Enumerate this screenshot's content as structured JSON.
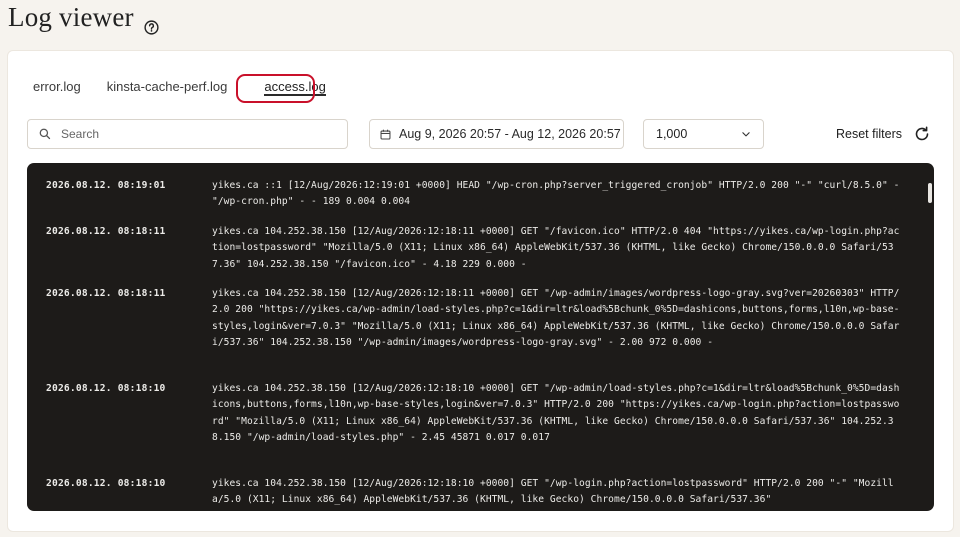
{
  "page": {
    "title": "Log viewer",
    "help_icon": "question-circle-icon"
  },
  "tabs": [
    {
      "label": "error.log",
      "active": false
    },
    {
      "label": "kinsta-cache-perf.log",
      "active": false
    },
    {
      "label": "access.log",
      "active": true
    }
  ],
  "filters": {
    "search_placeholder": "Search",
    "date_range": "Aug 9, 2026 20:57 - Aug 12, 2026 20:57",
    "lines_value": "1,000",
    "reset_label": "Reset filters"
  },
  "colors": {
    "highlight": "#c9102a",
    "log_bg": "#1d1b19"
  },
  "log_entries": [
    {
      "time": "2026.08.12. 08:19:01",
      "message": "yikes.ca ::1 [12/Aug/2026:12:19:01 +0000] HEAD \"/wp-cron.php?server_triggered_cronjob\" HTTP/2.0 200 \"-\" \"curl/8.5.0\" - \"/wp-cron.php\" - - 189 0.004 0.004"
    },
    {
      "time": "2026.08.12. 08:18:11",
      "message": "yikes.ca 104.252.38.150 [12/Aug/2026:12:18:11 +0000] GET \"/favicon.ico\" HTTP/2.0 404 \"https://yikes.ca/wp-login.php?action=lostpassword\" \"Mozilla/5.0 (X11; Linux x86_64) AppleWebKit/537.36 (KHTML, like Gecko) Chrome/150.0.0.0 Safari/537.36\" 104.252.38.150 \"/favicon.ico\" - 4.18 229 0.000 -"
    },
    {
      "time": "2026.08.12. 08:18:11",
      "message": "yikes.ca 104.252.38.150 [12/Aug/2026:12:18:11 +0000] GET \"/wp-admin/images/wordpress-logo-gray.svg?ver=20260303\" HTTP/2.0 200 \"https://yikes.ca/wp-admin/load-styles.php?c=1&dir=ltr&load%5Bchunk_0%5D=dashicons,buttons,forms,l10n,wp-base-styles,login&ver=7.0.3\" \"Mozilla/5.0 (X11; Linux x86_64) AppleWebKit/537.36 (KHTML, like Gecko) Chrome/150.0.0.0 Safari/537.36\" 104.252.38.150 \"/wp-admin/images/wordpress-logo-gray.svg\" - 2.00 972 0.000 -"
    },
    {
      "time": "2026.08.12. 08:18:10",
      "message": "yikes.ca 104.252.38.150 [12/Aug/2026:12:18:10 +0000] GET \"/wp-admin/load-styles.php?c=1&dir=ltr&load%5Bchunk_0%5D=dashicons,buttons,forms,l10n,wp-base-styles,login&ver=7.0.3\" HTTP/2.0 200 \"https://yikes.ca/wp-login.php?action=lostpassword\" \"Mozilla/5.0 (X11; Linux x86_64) AppleWebKit/537.36 (KHTML, like Gecko) Chrome/150.0.0.0 Safari/537.36\" 104.252.38.150 \"/wp-admin/load-styles.php\" - 2.45 45871 0.017 0.017"
    },
    {
      "time": "2026.08.12. 08:18:10",
      "message": "yikes.ca 104.252.38.150 [12/Aug/2026:12:18:10 +0000] GET \"/wp-login.php?action=lostpassword\" HTTP/2.0 200 \"-\" \"Mozilla/5.0 (X11; Linux x86_64) AppleWebKit/537.36 (KHTML, like Gecko) Chrome/150.0.0.0 Safari/537.36\""
    }
  ]
}
